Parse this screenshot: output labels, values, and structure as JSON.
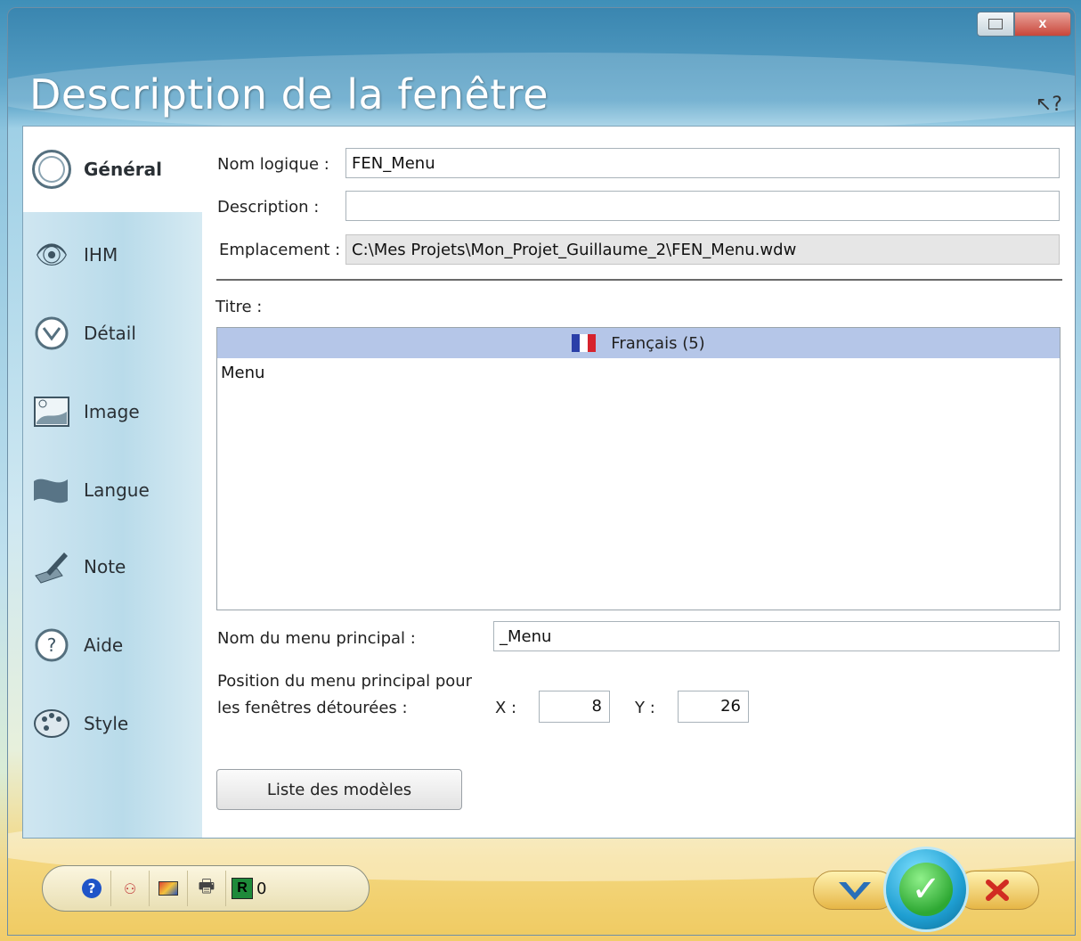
{
  "window": {
    "title": "Description de la fenêtre",
    "controls": {
      "restore_icon": "restore-icon",
      "close_label": "x"
    }
  },
  "sidebar": {
    "items": [
      {
        "label": "Général",
        "icon": "general-icon",
        "active": true
      },
      {
        "label": "IHM",
        "icon": "eye-icon"
      },
      {
        "label": "Détail",
        "icon": "detail-icon"
      },
      {
        "label": "Image",
        "icon": "image-icon"
      },
      {
        "label": "Langue",
        "icon": "flag-icon"
      },
      {
        "label": "Note",
        "icon": "note-icon"
      },
      {
        "label": "Aide",
        "icon": "help-icon"
      },
      {
        "label": "Style",
        "icon": "palette-icon"
      }
    ]
  },
  "form": {
    "nom_logique_label": "Nom logique :",
    "nom_logique_value": "FEN_Menu",
    "description_label": "Description :",
    "description_value": "",
    "emplacement_label": "Emplacement :",
    "emplacement_value": "C:\\Mes Projets\\Mon_Projet_Guillaume_2\\FEN_Menu.wdw",
    "titre_label": "Titre :",
    "language_tab": "Français (5)",
    "titre_value": "Menu",
    "menu_principal_label": "Nom du menu principal :",
    "menu_principal_value": "_Menu",
    "position_label_1": "Position du menu principal pour",
    "position_label_2": "les fenêtres détourées :",
    "x_label": "X :",
    "x_value": "8",
    "y_label": "Y :",
    "y_value": "26",
    "models_button": "Liste des modèles"
  },
  "toolbar": {
    "counter": "0"
  }
}
